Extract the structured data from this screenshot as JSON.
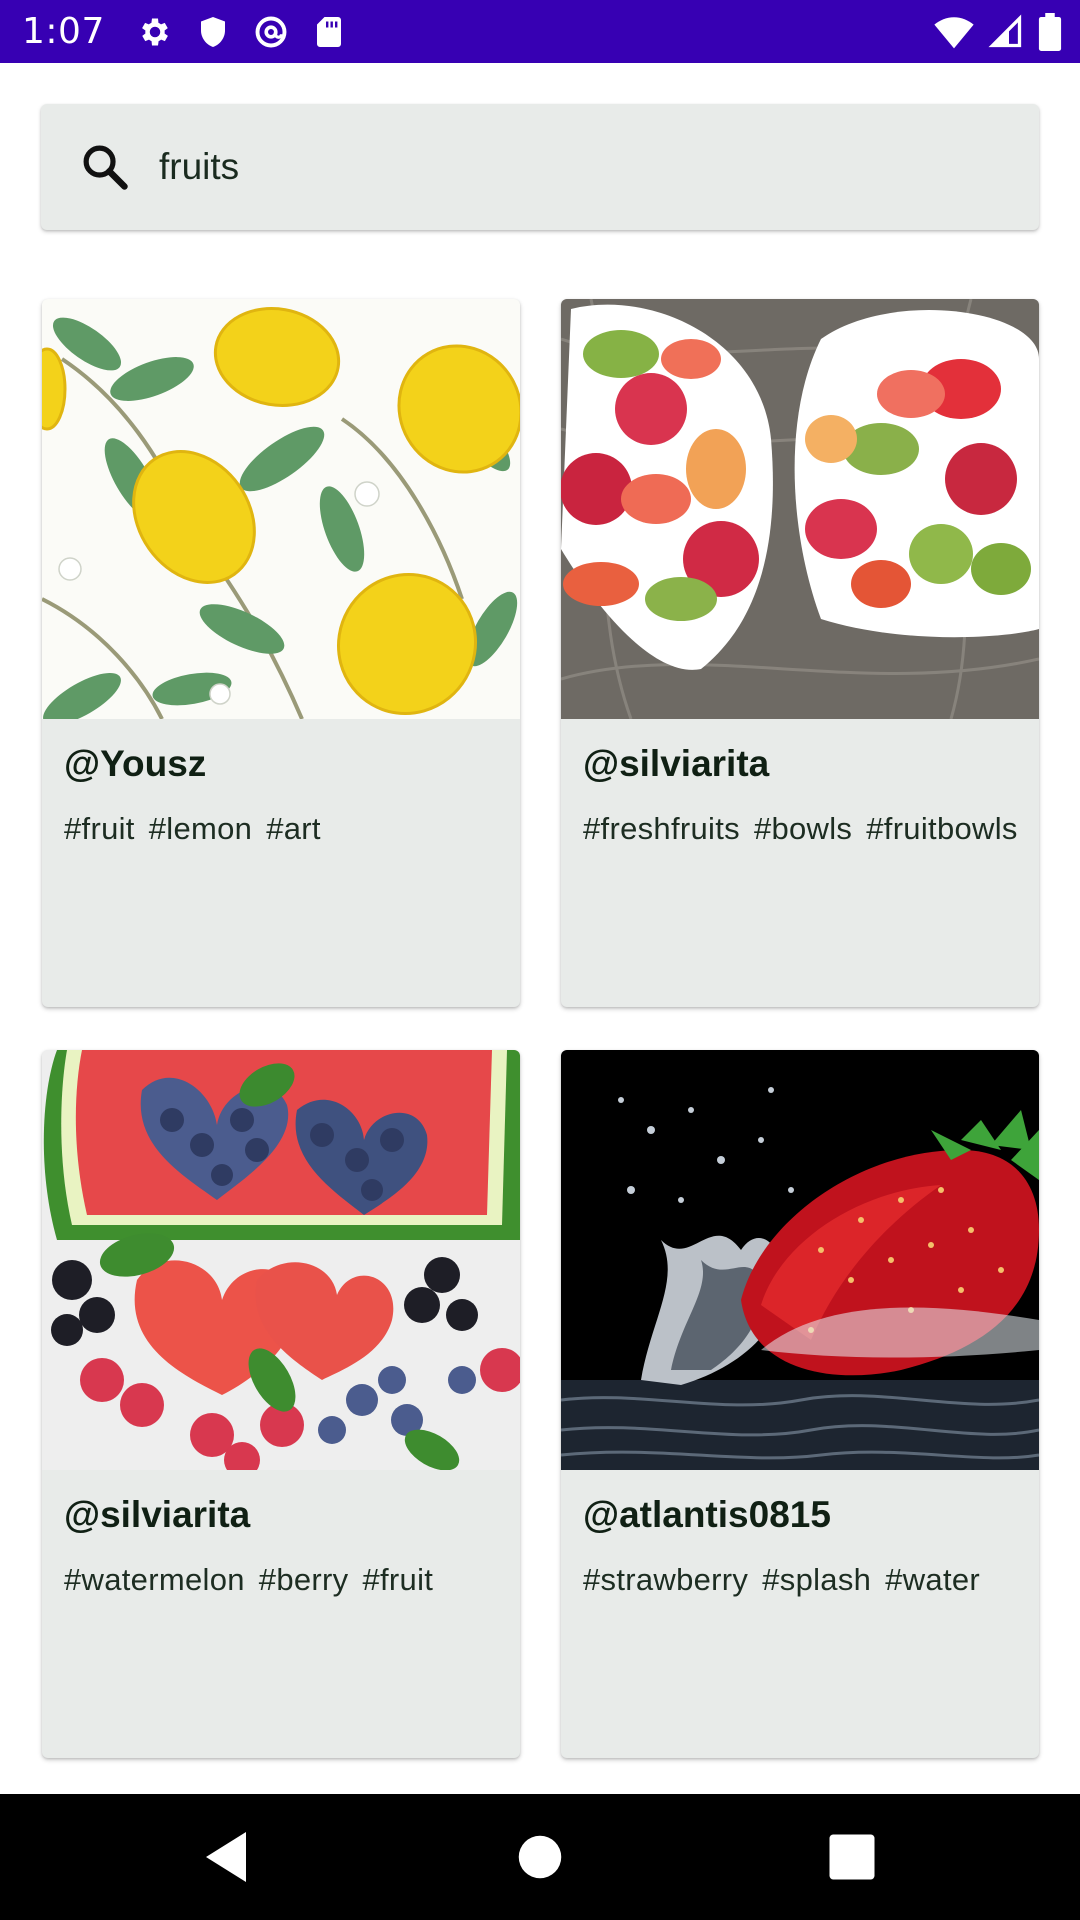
{
  "status_bar": {
    "time": "1:07",
    "left_icons": [
      "settings-gear-icon",
      "shield-icon",
      "at-sign-circle-icon",
      "sd-card-icon"
    ],
    "right_icons": [
      "wifi-icon",
      "cell-signal-icon",
      "battery-icon"
    ]
  },
  "search": {
    "value": "fruits",
    "icon": "search-icon"
  },
  "cards": [
    {
      "author": "@Yousz",
      "tags": [
        "#fruit",
        "#lemon",
        "#art"
      ],
      "image": "lemons-illustration"
    },
    {
      "author": "@silviarita",
      "tags": [
        "#freshfruits",
        "#bowls",
        "#fruitbowls"
      ],
      "image": "fruit-bowls"
    },
    {
      "author": "@silviarita",
      "tags": [
        "#watermelon",
        "#berry",
        "#fruit"
      ],
      "image": "watermelon-hearts"
    },
    {
      "author": "@atlantis0815",
      "tags": [
        "#strawberry",
        "#splash",
        "#water"
      ],
      "image": "strawberry-splash"
    }
  ],
  "nav": {
    "icons": [
      "back-triangle-icon",
      "home-circle-icon",
      "recents-square-icon"
    ]
  },
  "colors": {
    "status_bar": "#3700b3",
    "card_background": "#e8ebe9",
    "nav_bar": "#000000"
  }
}
